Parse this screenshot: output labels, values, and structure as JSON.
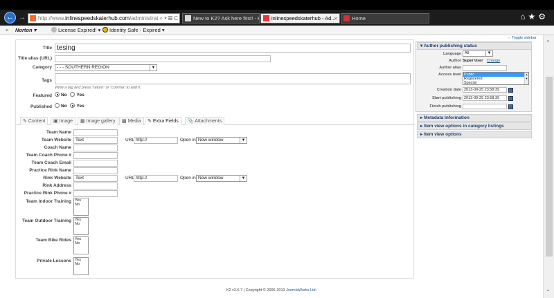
{
  "browser": {
    "address": {
      "prefix": "http://www.",
      "domain": "inlinespeedskaterhub.com",
      "path": "/administrat"
    },
    "tabs": [
      {
        "label": "New to K2? Ask here first! - K2..."
      },
      {
        "label": "inlinespeedskaterhub - Ad..."
      },
      {
        "label": "Home"
      }
    ]
  },
  "norton": {
    "brand": "Norton",
    "license": "License Expired!",
    "identity": "Identity Safe - Expired"
  },
  "form": {
    "title_label": "Title",
    "title_value": "tesing",
    "alias_label": "Title alias (URL)",
    "alias_value": "",
    "category_label": "Category",
    "category_value": "- - - SOUTHERN REGION",
    "tags_label": "Tags",
    "tags_note": "Write a tag and press \"return\" or \"comma\" to add it.",
    "featured_label": "Featured",
    "published_label": "Published",
    "no": "No",
    "yes": "Yes"
  },
  "tabs": [
    "Content",
    "Image",
    "Image gallery",
    "Media",
    "Extra Fields",
    "Attachments"
  ],
  "extra": {
    "team_name": "Team Name",
    "team_website": "Team Website",
    "coach_name": "Coach Name",
    "team_coach_phone": "Team Coach Phone #",
    "team_coach_email": "Team Coach Email",
    "practice_rink_name": "Practice Rink Name",
    "rink_website": "Rink Website",
    "rink_address": "Rink Address",
    "practice_rink_phone": "Practice Rink Phone #",
    "team_indoor": "Team Indoor Training",
    "team_outdoor": "Team Outdoor Training",
    "team_bike": "Team Bike Rides",
    "private_lessons": "Private Lessons",
    "text_label": "Text",
    "url_label": "URL",
    "url_placeholder": "http://",
    "open_in_label": "Open in",
    "open_in_value": "New window",
    "yes": "Yes",
    "no": "No"
  },
  "sidebar": {
    "toggle": "Toggle sidebar",
    "author_status": "Author publishing status",
    "language_label": "Language",
    "language_value": "All",
    "author_label": "Author",
    "author_value": "Super User",
    "change": "Change",
    "author_alias_label": "Author alias",
    "access_label": "Access level",
    "access_options": [
      "Public",
      "Registered",
      "Special"
    ],
    "creation_label": "Creation date",
    "creation_value": "2013-09-25 23:58:39",
    "start_label": "Start publishing",
    "start_value": "2013-09-25 23:58:39",
    "finish_label": "Finish publishing",
    "metadata": "Metadata Information",
    "view_category": "Item view options in category listings",
    "view_options": "Item view options"
  },
  "footer": {
    "version": "K2 v2.6.7",
    "copyright": "| Copyright © 2006-2013",
    "company": "JoomlaWorks Ltd."
  }
}
